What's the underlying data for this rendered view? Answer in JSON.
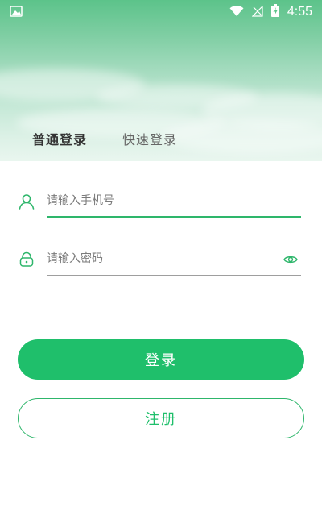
{
  "status_bar": {
    "time": "4:55",
    "icons": [
      "image-icon",
      "wifi-icon",
      "no-signal-icon",
      "battery-charging-icon"
    ]
  },
  "tabs": [
    {
      "label": "普通登录",
      "active": true
    },
    {
      "label": "快速登录",
      "active": false
    }
  ],
  "form": {
    "phone": {
      "placeholder": "请输入手机号",
      "value": "",
      "icon": "user-icon"
    },
    "password": {
      "placeholder": "请输入密码",
      "value": "",
      "icon": "lock-icon",
      "toggle_icon": "eye-icon"
    }
  },
  "buttons": {
    "login_label": "登录",
    "register_label": "注册"
  },
  "colors": {
    "accent": "#1fbf6b",
    "header_top": "#5cc38a",
    "text_primary": "#333333",
    "text_secondary": "#666666"
  }
}
